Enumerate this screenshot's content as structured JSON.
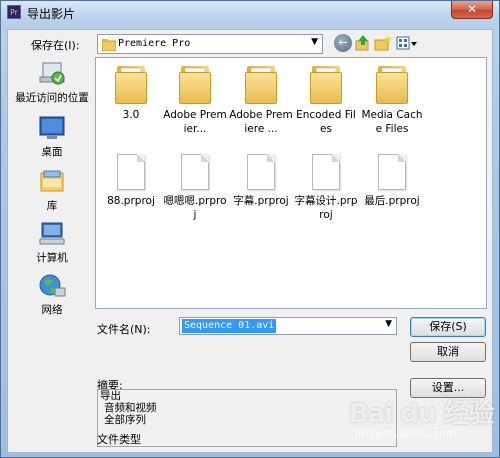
{
  "window": {
    "title": "导出影片",
    "close_label": "✕",
    "app_icon_label": "Pr"
  },
  "toolbar": {
    "lookin_label": "保存在(I):",
    "lookin_value": "Premiere Pro",
    "icons": [
      "back-icon",
      "up-folder-icon",
      "new-folder-icon",
      "views-menu-icon"
    ]
  },
  "places": [
    {
      "label": "最近访问的位置",
      "icon": "recent-places-icon"
    },
    {
      "label": "桌面",
      "icon": "desktop-icon"
    },
    {
      "label": "库",
      "icon": "libraries-icon"
    },
    {
      "label": "计算机",
      "icon": "computer-icon"
    },
    {
      "label": "网络",
      "icon": "network-icon"
    }
  ],
  "files": [
    {
      "name": "3.0",
      "type": "folder"
    },
    {
      "name": "Adobe Premier...",
      "type": "folder"
    },
    {
      "name": "Adobe Premiere ...",
      "type": "folder"
    },
    {
      "name": "Encoded Files",
      "type": "folder"
    },
    {
      "name": "Media Cache Files",
      "type": "folder"
    },
    {
      "name": "88.prproj",
      "type": "file"
    },
    {
      "name": "嗯嗯嗯.prproj",
      "type": "file"
    },
    {
      "name": "字幕.prproj",
      "type": "file"
    },
    {
      "name": "字幕设计.prproj",
      "type": "file"
    },
    {
      "name": "最后.prproj",
      "type": "file"
    }
  ],
  "filename": {
    "label": "文件名(N):",
    "value": "Sequence 01.avi"
  },
  "buttons": {
    "save": "保存(S)",
    "cancel": "取消",
    "settings": "设置..."
  },
  "summary": {
    "label": "摘要:",
    "lines": [
      "导出",
      "音频和视频",
      "全部序列"
    ]
  },
  "filetype_label": "文件类型",
  "watermark": {
    "text": "Bai du 经验",
    "url": "jingyan.baidu.com"
  }
}
